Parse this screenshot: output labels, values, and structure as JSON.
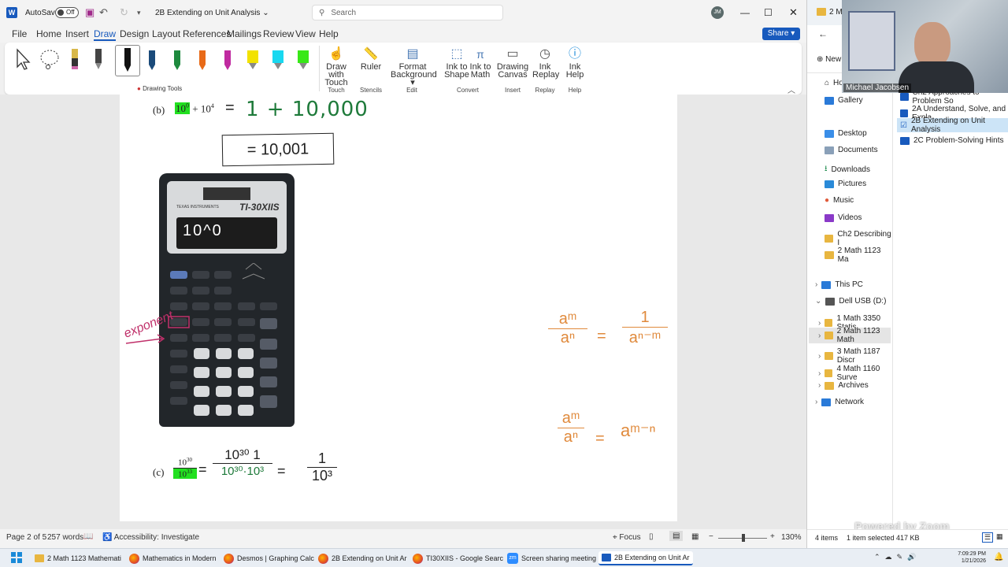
{
  "word": {
    "title_bar": {
      "autosave": "AutoSave",
      "toggle": "Off",
      "doc_title": "2B Extending on Unit Analysis",
      "search_placeholder": "Search",
      "user_initials": "JM"
    },
    "menu": [
      "File",
      "Home",
      "Insert",
      "Draw",
      "Design",
      "Layout",
      "References",
      "Mailings",
      "Review",
      "View",
      "Help"
    ],
    "share_label": "Share",
    "ribbon": {
      "drawing_tools": "Drawing Tools",
      "buttons": [
        {
          "l1": "Draw with",
          "l2": "Touch"
        },
        {
          "l1": "Ruler",
          "l2": ""
        },
        {
          "l1": "Format",
          "l2": "Background"
        },
        {
          "l1": "Ink to",
          "l2": "Shape"
        },
        {
          "l1": "Ink to",
          "l2": "Math"
        },
        {
          "l1": "Drawing",
          "l2": "Canvas"
        },
        {
          "l1": "Ink",
          "l2": "Replay"
        },
        {
          "l1": "Ink",
          "l2": "Help"
        }
      ],
      "groups": [
        "Touch",
        "Stencils",
        "Edit",
        "Convert",
        "Insert",
        "Replay",
        "Help"
      ]
    },
    "doc": {
      "b_label": "(b)",
      "b_base1": "10",
      "b_exp1": "0",
      "b_plus": "+",
      "b_base2": "10",
      "b_exp2": "4",
      "b_eq": "=",
      "b_hand": "1 + 10,000",
      "b_boxed": "= 10,001",
      "calc": {
        "brand": "TEXAS INSTRUMENTS",
        "model": "TI-30XIIS",
        "display": "10^0",
        "annotation": "exponent"
      },
      "c_label": "(c)",
      "c_num": "10",
      "c_num_exp": "30",
      "c_den": "10",
      "c_den_exp": "33",
      "c_eq": "=",
      "c_hand_num": "10³⁰ 1",
      "c_hand_den": "10³⁰·10³",
      "c_hand_eq": "=",
      "c_result_num": "1",
      "c_result_den": "10³",
      "rule1_lhs_num": "aᵐ",
      "rule1_lhs_den": "aⁿ",
      "rule1_eq": "=",
      "rule1_rhs_num": "1",
      "rule1_rhs_den": "aⁿ⁻ᵐ",
      "rule2_lhs_num": "aᵐ",
      "rule2_lhs_den": "aⁿ",
      "rule2_eq": "=",
      "rule2_rhs": "aᵐ⁻ⁿ"
    },
    "status": {
      "page": "Page 2 of 5",
      "words": "257 words",
      "accessibility": "Accessibility: Investigate",
      "focus": "Focus",
      "zoom": "130%"
    }
  },
  "explorer": {
    "tab": "2 M",
    "new": "New",
    "home": "Home",
    "gallery": "Gallery",
    "quick": [
      "Desktop",
      "Documents",
      "Downloads",
      "Pictures",
      "Music",
      "Videos",
      "Ch2 Describing I",
      "2 Math 1123 Ma"
    ],
    "this_pc": "This PC",
    "drive": "Dell USB (D:)",
    "drive_items": [
      "1 Math 3350 Statis",
      "2 Math 1123 Math",
      "3 Math 1187 Discr",
      "4 Math 1160 Surve",
      "Archives"
    ],
    "network": "Network",
    "files": [
      "Ch2 Approaches to Problem So",
      "2A Understand, Solve, and Expla",
      "2B Extending on Unit Analysis",
      "2C Problem-Solving Hints"
    ],
    "status_items": "4 items",
    "status_selected": "1 item selected  417 KB",
    "webcam_name": "Michael Jacobsen",
    "watermark": "Powered by Zoom"
  },
  "taskbar": {
    "items": [
      "2 Math 1123 Mathemati",
      "Mathematics in Modern",
      "Desmos | Graphing Calc",
      "2B Extending on Unit Ar",
      "TI30XIIS - Google Searc",
      "Screen sharing meeting",
      "2B Extending on Unit Ar"
    ],
    "time": "7:09:29 PM",
    "date": "1/21/2026"
  },
  "colors": {
    "accent": "#185abd",
    "highlight": "#22e020",
    "ink_green": "#2e8b57",
    "ink_orange": "#e08a3c",
    "ink_pink": "#c0306a"
  }
}
